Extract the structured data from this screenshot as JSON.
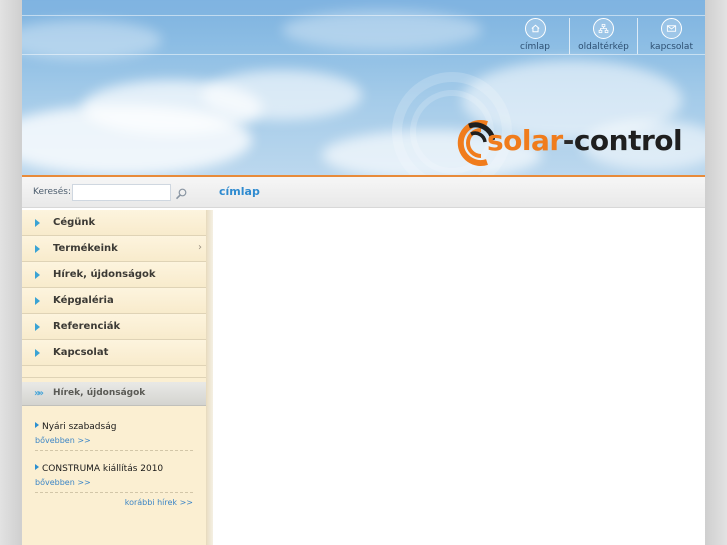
{
  "topnav": {
    "items": [
      {
        "label": "címlap",
        "icon": "home-icon"
      },
      {
        "label": "oldaltérkép",
        "icon": "sitemap-icon"
      },
      {
        "label": "kapcsolat",
        "icon": "mail-icon"
      }
    ]
  },
  "logo": {
    "solar": "solar",
    "dash": "-",
    "control": "control"
  },
  "search": {
    "label": "Keresés:",
    "value": "",
    "placeholder": ""
  },
  "page_title": "címlap",
  "sidebar": {
    "menu": [
      {
        "label": "Cégünk"
      },
      {
        "label": "Termékeink",
        "chevron": "›"
      },
      {
        "label": "Hírek, újdonságok"
      },
      {
        "label": "Képgaléria"
      },
      {
        "label": "Referenciák"
      },
      {
        "label": "Kapcsolat"
      }
    ],
    "news": {
      "title": "Hírek, újdonságok",
      "items": [
        {
          "title": "Nyári szabadság",
          "more": "bővebben >>"
        },
        {
          "title": "CONSTRUMA kiállítás 2010",
          "more": "bővebben >>"
        }
      ],
      "older": "korábbi hírek >>"
    }
  },
  "colors": {
    "accent_blue": "#2f8bd0",
    "logo_orange": "#f07c1c",
    "sidebar_bg": "#fbefd2"
  }
}
